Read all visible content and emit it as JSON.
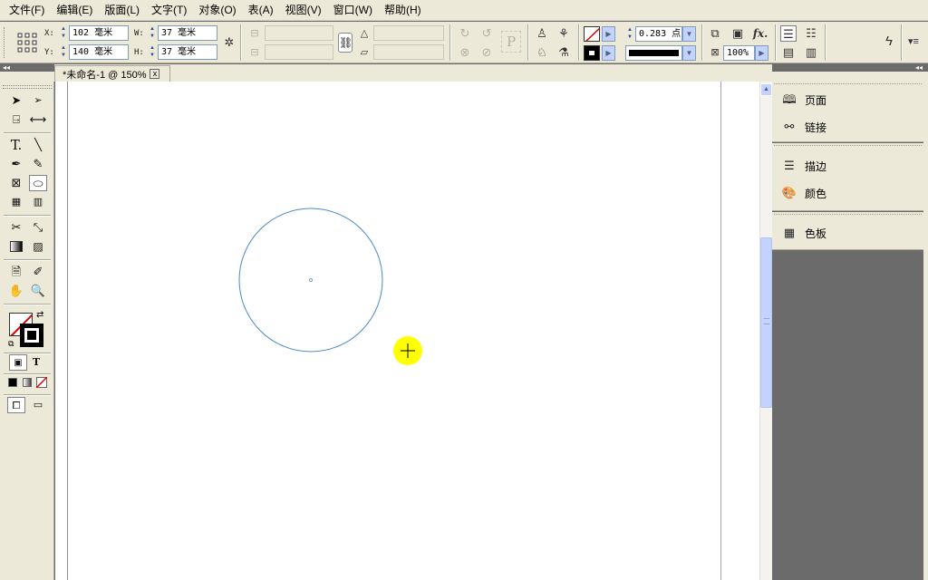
{
  "menu": [
    "文件(F)",
    "编辑(E)",
    "版面(L)",
    "文字(T)",
    "对象(O)",
    "表(A)",
    "视图(V)",
    "窗口(W)",
    "帮助(H)"
  ],
  "control": {
    "x_label": "X:",
    "y_label": "Y:",
    "w_label": "W:",
    "h_label": "H:",
    "x_value": "102 毫米",
    "y_value": "140 毫米",
    "w_value": "37 毫米",
    "h_value": "37 毫米",
    "stroke_weight": "0.283 点",
    "opacity": "100%",
    "fx_label": "fx.",
    "p_label": "P"
  },
  "document": {
    "tab_title": "*未命名-1 @ 150%",
    "close_glyph": "x"
  },
  "panels": {
    "group1": [
      "页面",
      "链接"
    ],
    "group2": [
      "描边",
      "颜色"
    ],
    "group3": [
      "色板"
    ]
  },
  "tools": {
    "type_tool_glyph": "T.",
    "format_text_glyph": "T"
  },
  "colors": {
    "chrome": "#ece9d8",
    "workspace": "#6b6b6b",
    "circle_stroke": "#4a8ac8",
    "cursor_highlight": "#ffff00",
    "scroll_blue": "#c3d3fd"
  }
}
